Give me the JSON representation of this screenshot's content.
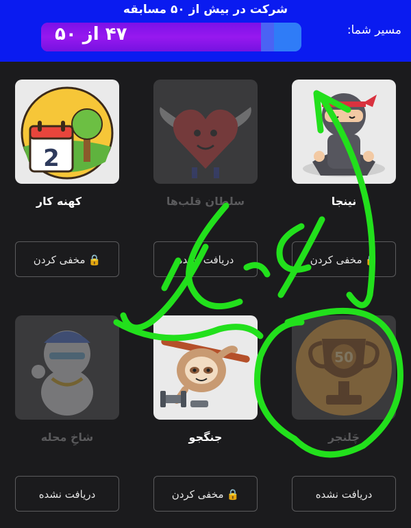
{
  "header": {
    "title": "شرکت در بیش از ۵۰ مسابقه",
    "path_label": "مسیر شما:",
    "progress_text": "۴۷ از ۵۰",
    "progress_fraction": 0.94
  },
  "badges": [
    {
      "title": "کهنه کار",
      "earned": true,
      "button": {
        "label": "مخفی کردن",
        "locked": true
      },
      "icon": "calendar-tree-icon"
    },
    {
      "title": "سلطان قلب‌ها",
      "earned": false,
      "button": {
        "label": "دریافت نشده",
        "locked": false
      },
      "icon": "winged-heart-icon"
    },
    {
      "title": "نینجا",
      "earned": true,
      "button": {
        "label": "مخفی کردن",
        "locked": true
      },
      "icon": "ninja-icon"
    },
    {
      "title": "شاخِ محله",
      "earned": false,
      "button": {
        "label": "دریافت نشده",
        "locked": false
      },
      "icon": "bear-icon"
    },
    {
      "title": "جنگجو",
      "earned": true,
      "button": {
        "label": "مخفی کردن",
        "locked": true
      },
      "icon": "sloth-icon"
    },
    {
      "title": "چَلنجر",
      "earned": false,
      "button": {
        "label": "دریافت نشده",
        "locked": false
      },
      "icon": "trophy-50-icon"
    }
  ],
  "trophy_number": "50",
  "calendar_number": "2",
  "annotation": {
    "handwritten_text": "نه کلش",
    "color": "#22e01c"
  }
}
